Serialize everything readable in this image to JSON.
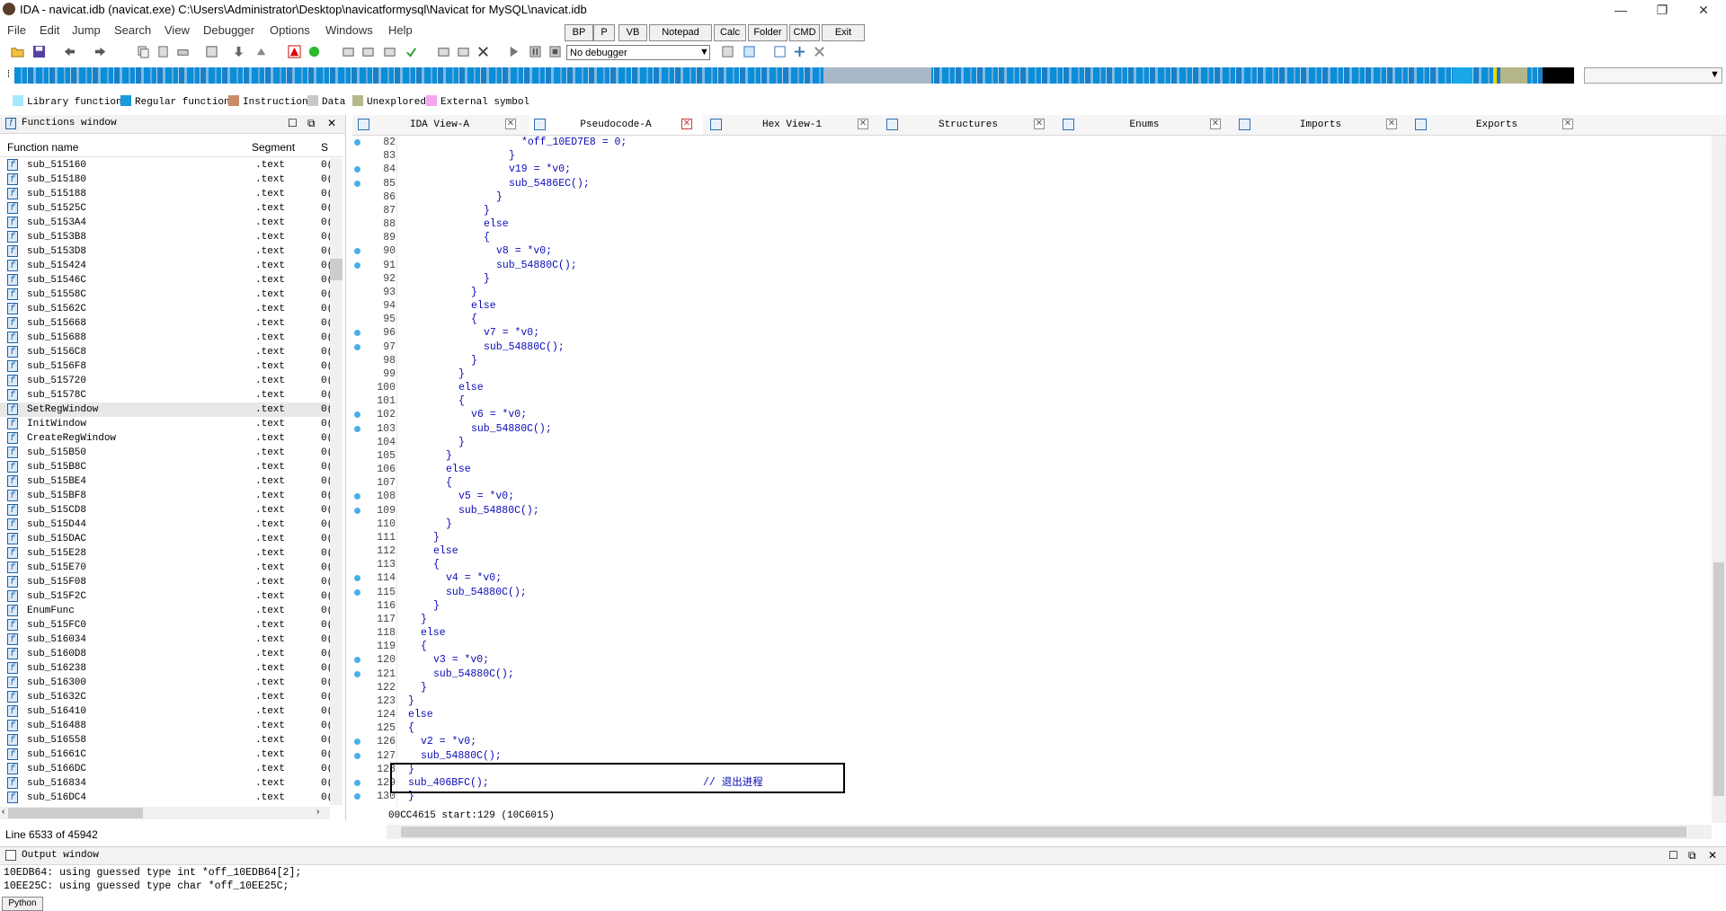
{
  "titlebar": {
    "title": "IDA - navicat.idb (navicat.exe) C:\\Users\\Administrator\\Desktop\\navicatformysql\\Navicat for MySQL\\navicat.idb",
    "minimize": "—",
    "restore": "❐",
    "close": "✕"
  },
  "menu": [
    "File",
    "Edit",
    "Jump",
    "Search",
    "View",
    "Debugger",
    "Options",
    "Windows",
    "Help"
  ],
  "quick_buttons": [
    "BP",
    "P",
    "VB",
    "Notepad",
    "Calc",
    "Folder",
    "CMD",
    "Exit"
  ],
  "toolbar": {
    "debugger_select": "No debugger"
  },
  "legend": [
    {
      "label": "Library function",
      "color": "#a6e8ff"
    },
    {
      "label": "Regular function",
      "color": "#1a9be0"
    },
    {
      "label": "Instruction",
      "color": "#c98a6a"
    },
    {
      "label": "Data",
      "color": "#c8c8c8"
    },
    {
      "label": "Unexplored",
      "color": "#b8b88e"
    },
    {
      "label": "External symbol",
      "color": "#f2a6f2"
    }
  ],
  "functions_window": {
    "title": "Functions window",
    "col_name": "Function name",
    "col_segment": "Segment",
    "col_start": "S",
    "rows": [
      {
        "name": "sub_515160",
        "segment": ".text",
        "start": "0("
      },
      {
        "name": "sub_515180",
        "segment": ".text",
        "start": "0("
      },
      {
        "name": "sub_515188",
        "segment": ".text",
        "start": "0("
      },
      {
        "name": "sub_51525C",
        "segment": ".text",
        "start": "0("
      },
      {
        "name": "sub_5153A4",
        "segment": ".text",
        "start": "0("
      },
      {
        "name": "sub_5153B8",
        "segment": ".text",
        "start": "0("
      },
      {
        "name": "sub_5153D8",
        "segment": ".text",
        "start": "0("
      },
      {
        "name": "sub_515424",
        "segment": ".text",
        "start": "0("
      },
      {
        "name": "sub_51546C",
        "segment": ".text",
        "start": "0("
      },
      {
        "name": "sub_51558C",
        "segment": ".text",
        "start": "0("
      },
      {
        "name": "sub_51562C",
        "segment": ".text",
        "start": "0("
      },
      {
        "name": "sub_515668",
        "segment": ".text",
        "start": "0("
      },
      {
        "name": "sub_515688",
        "segment": ".text",
        "start": "0("
      },
      {
        "name": "sub_5156C8",
        "segment": ".text",
        "start": "0("
      },
      {
        "name": "sub_5156F8",
        "segment": ".text",
        "start": "0("
      },
      {
        "name": "sub_515720",
        "segment": ".text",
        "start": "0("
      },
      {
        "name": "sub_51578C",
        "segment": ".text",
        "start": "0("
      },
      {
        "name": "SetRegWindow",
        "segment": ".text",
        "start": "0("
      },
      {
        "name": "InitWindow",
        "segment": ".text",
        "start": "0("
      },
      {
        "name": "CreateRegWindow",
        "segment": ".text",
        "start": "0("
      },
      {
        "name": "sub_515B50",
        "segment": ".text",
        "start": "0("
      },
      {
        "name": "sub_515B8C",
        "segment": ".text",
        "start": "0("
      },
      {
        "name": "sub_515BE4",
        "segment": ".text",
        "start": "0("
      },
      {
        "name": "sub_515BF8",
        "segment": ".text",
        "start": "0("
      },
      {
        "name": "sub_515CD8",
        "segment": ".text",
        "start": "0("
      },
      {
        "name": "sub_515D44",
        "segment": ".text",
        "start": "0("
      },
      {
        "name": "sub_515DAC",
        "segment": ".text",
        "start": "0("
      },
      {
        "name": "sub_515E28",
        "segment": ".text",
        "start": "0("
      },
      {
        "name": "sub_515E70",
        "segment": ".text",
        "start": "0("
      },
      {
        "name": "sub_515F08",
        "segment": ".text",
        "start": "0("
      },
      {
        "name": "sub_515F2C",
        "segment": ".text",
        "start": "0("
      },
      {
        "name": "EnumFunc",
        "segment": ".text",
        "start": "0("
      },
      {
        "name": "sub_515FC0",
        "segment": ".text",
        "start": "0("
      },
      {
        "name": "sub_516034",
        "segment": ".text",
        "start": "0("
      },
      {
        "name": "sub_5160D8",
        "segment": ".text",
        "start": "0("
      },
      {
        "name": "sub_516238",
        "segment": ".text",
        "start": "0("
      },
      {
        "name": "sub_516300",
        "segment": ".text",
        "start": "0("
      },
      {
        "name": "sub_51632C",
        "segment": ".text",
        "start": "0("
      },
      {
        "name": "sub_516410",
        "segment": ".text",
        "start": "0("
      },
      {
        "name": "sub_516488",
        "segment": ".text",
        "start": "0("
      },
      {
        "name": "sub_516558",
        "segment": ".text",
        "start": "0("
      },
      {
        "name": "sub_51661C",
        "segment": ".text",
        "start": "0("
      },
      {
        "name": "sub_5166DC",
        "segment": ".text",
        "start": "0("
      },
      {
        "name": "sub_516834",
        "segment": ".text",
        "start": "0("
      },
      {
        "name": "sub_516DC4",
        "segment": ".text",
        "start": "0("
      }
    ],
    "selected_index": 17,
    "status": "Line 6533 of 45942"
  },
  "tabs": [
    {
      "label": "IDA View-A",
      "active": false
    },
    {
      "label": "Pseudocode-A",
      "active": true
    },
    {
      "label": "Hex View-1",
      "active": false
    },
    {
      "label": "Structures",
      "active": false
    },
    {
      "label": "Enums",
      "active": false
    },
    {
      "label": "Imports",
      "active": false
    },
    {
      "label": "Exports",
      "active": false
    }
  ],
  "code_lines": [
    {
      "n": "82",
      "dot": true,
      "indent": 9,
      "code": "*off_10ED7E8 = 0;"
    },
    {
      "n": "83",
      "dot": false,
      "indent": 8,
      "code": "}"
    },
    {
      "n": "84",
      "dot": true,
      "indent": 8,
      "code": "v19 = *v0;"
    },
    {
      "n": "85",
      "dot": true,
      "indent": 8,
      "code": "sub_5486EC();"
    },
    {
      "n": "86",
      "dot": false,
      "indent": 7,
      "code": "}"
    },
    {
      "n": "87",
      "dot": false,
      "indent": 6,
      "code": "}"
    },
    {
      "n": "88",
      "dot": false,
      "indent": 6,
      "code": "else"
    },
    {
      "n": "89",
      "dot": false,
      "indent": 6,
      "code": "{"
    },
    {
      "n": "90",
      "dot": true,
      "indent": 7,
      "code": "v8 = *v0;"
    },
    {
      "n": "91",
      "dot": true,
      "indent": 7,
      "code": "sub_54880C();"
    },
    {
      "n": "92",
      "dot": false,
      "indent": 6,
      "code": "}"
    },
    {
      "n": "93",
      "dot": false,
      "indent": 5,
      "code": "}"
    },
    {
      "n": "94",
      "dot": false,
      "indent": 5,
      "code": "else"
    },
    {
      "n": "95",
      "dot": false,
      "indent": 5,
      "code": "{"
    },
    {
      "n": "96",
      "dot": true,
      "indent": 6,
      "code": "v7 = *v0;"
    },
    {
      "n": "97",
      "dot": true,
      "indent": 6,
      "code": "sub_54880C();"
    },
    {
      "n": "98",
      "dot": false,
      "indent": 5,
      "code": "}"
    },
    {
      "n": "99",
      "dot": false,
      "indent": 4,
      "code": "}"
    },
    {
      "n": "100",
      "dot": false,
      "indent": 4,
      "code": "else"
    },
    {
      "n": "101",
      "dot": false,
      "indent": 4,
      "code": "{"
    },
    {
      "n": "102",
      "dot": true,
      "indent": 5,
      "code": "v6 = *v0;"
    },
    {
      "n": "103",
      "dot": true,
      "indent": 5,
      "code": "sub_54880C();"
    },
    {
      "n": "104",
      "dot": false,
      "indent": 4,
      "code": "}"
    },
    {
      "n": "105",
      "dot": false,
      "indent": 3,
      "code": "}"
    },
    {
      "n": "106",
      "dot": false,
      "indent": 3,
      "code": "else"
    },
    {
      "n": "107",
      "dot": false,
      "indent": 3,
      "code": "{"
    },
    {
      "n": "108",
      "dot": true,
      "indent": 4,
      "code": "v5 = *v0;"
    },
    {
      "n": "109",
      "dot": true,
      "indent": 4,
      "code": "sub_54880C();"
    },
    {
      "n": "110",
      "dot": false,
      "indent": 3,
      "code": "}"
    },
    {
      "n": "111",
      "dot": false,
      "indent": 2,
      "code": "}"
    },
    {
      "n": "112",
      "dot": false,
      "indent": 2,
      "code": "else"
    },
    {
      "n": "113",
      "dot": false,
      "indent": 2,
      "code": "{"
    },
    {
      "n": "114",
      "dot": true,
      "indent": 3,
      "code": "v4 = *v0;"
    },
    {
      "n": "115",
      "dot": true,
      "indent": 3,
      "code": "sub_54880C();"
    },
    {
      "n": "116",
      "dot": false,
      "indent": 2,
      "code": "}"
    },
    {
      "n": "117",
      "dot": false,
      "indent": 1,
      "code": "}"
    },
    {
      "n": "118",
      "dot": false,
      "indent": 1,
      "code": "else"
    },
    {
      "n": "119",
      "dot": false,
      "indent": 1,
      "code": "{"
    },
    {
      "n": "120",
      "dot": true,
      "indent": 2,
      "code": "v3 = *v0;"
    },
    {
      "n": "121",
      "dot": true,
      "indent": 2,
      "code": "sub_54880C();"
    },
    {
      "n": "122",
      "dot": false,
      "indent": 1,
      "code": "}"
    },
    {
      "n": "123",
      "dot": false,
      "indent": 0,
      "code": "}"
    },
    {
      "n": "124",
      "dot": false,
      "indent": 0,
      "code": "else"
    },
    {
      "n": "125",
      "dot": false,
      "indent": 0,
      "code": "{"
    },
    {
      "n": "126",
      "dot": true,
      "indent": 1,
      "code": "v2 = *v0;"
    },
    {
      "n": "127",
      "dot": true,
      "indent": 1,
      "code": "sub_54880C();"
    },
    {
      "n": "128",
      "dot": false,
      "indent": 0,
      "code": "}"
    },
    {
      "n": "129",
      "dot": true,
      "indent": 0,
      "code": "sub_406BFC();",
      "comment": "// 退出进程"
    },
    {
      "n": "130",
      "dot": true,
      "indent": 0,
      "code": "}"
    }
  ],
  "code_status": "00CC4615 start:129 (10C6015)",
  "output_window": {
    "title": "Output window",
    "lines": [
      "10EDB64: using guessed type int *off_10EDB64[2];",
      "10EE25C: using guessed type char *off_10EE25C;"
    ],
    "button": "Python"
  }
}
